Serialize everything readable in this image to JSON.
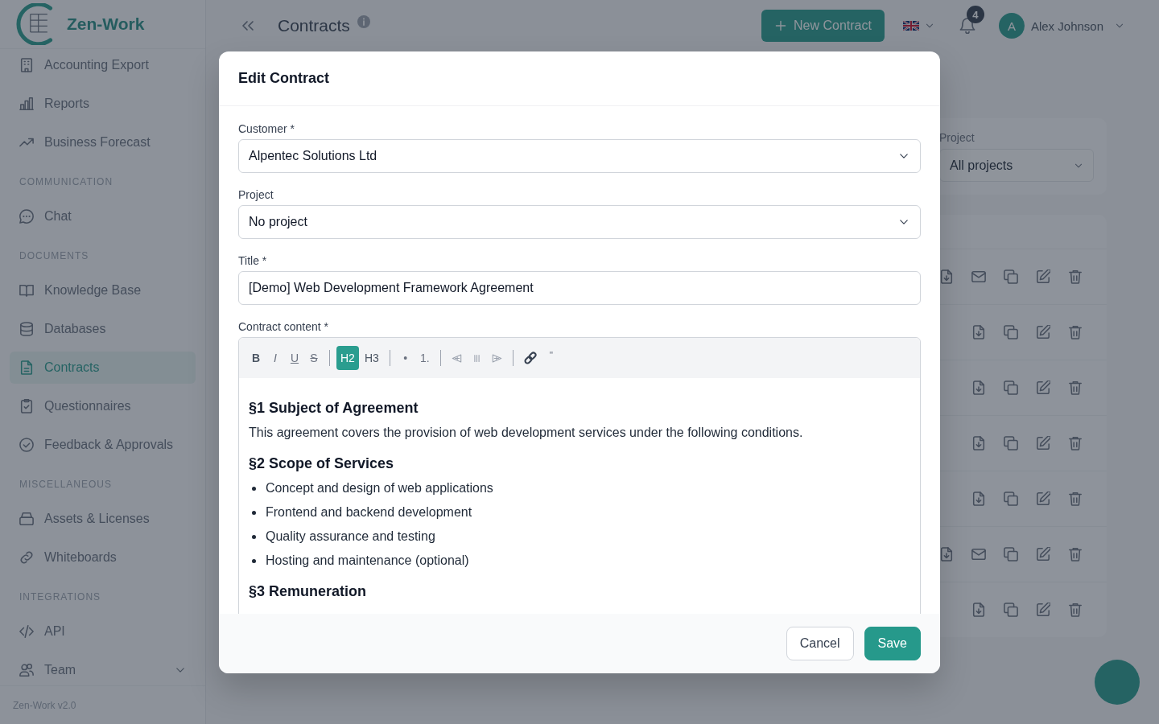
{
  "sidebar": {
    "logo": "Zen-Work",
    "sections": [
      {
        "items": [
          {
            "label": "Accounting Export",
            "selected": false
          },
          {
            "label": "Reports",
            "selected": false
          },
          {
            "label": "Business Forecast",
            "selected": false
          }
        ]
      },
      {
        "title": "COMMUNICATION",
        "items": [
          {
            "label": "Chat",
            "selected": false
          }
        ]
      },
      {
        "title": "DOCUMENTS",
        "items": [
          {
            "label": "Knowledge Base",
            "selected": false
          },
          {
            "label": "Databases",
            "selected": false
          },
          {
            "label": "Contracts",
            "selected": true
          },
          {
            "label": "Questionnaires",
            "selected": false
          },
          {
            "label": "Feedback & Approvals",
            "selected": false
          }
        ]
      },
      {
        "title": "MISCELLANEOUS",
        "items": [
          {
            "label": "Assets & Licenses",
            "selected": false
          },
          {
            "label": "Whiteboards",
            "selected": false
          }
        ]
      },
      {
        "title": "INTEGRATIONS",
        "items": [
          {
            "label": "API",
            "selected": false
          },
          {
            "label": "Team",
            "selected": false,
            "expanded": false
          }
        ]
      }
    ],
    "version": "Zen-Work v2.0"
  },
  "header": {
    "title": "Contracts",
    "new_button": "New Contract",
    "notification_count": "4",
    "user": {
      "initial": "A",
      "name": "Alex Johnson"
    }
  },
  "filters": {
    "label": "Project",
    "value": "All projects"
  },
  "table": {
    "rows": [
      {
        "actions": [
          {
            "kind": "download"
          },
          {
            "kind": "mail"
          },
          {
            "kind": "copy"
          },
          {
            "kind": "edit"
          },
          {
            "kind": "trash"
          }
        ]
      },
      {
        "actions": [
          {
            "kind": "download"
          },
          {
            "kind": "copy"
          },
          {
            "kind": "edit"
          },
          {
            "kind": "trash"
          }
        ]
      },
      {
        "actions": [
          {
            "kind": "download"
          },
          {
            "kind": "copy"
          },
          {
            "kind": "edit"
          },
          {
            "kind": "trash"
          }
        ]
      },
      {
        "actions": [
          {
            "kind": "download"
          },
          {
            "kind": "copy"
          },
          {
            "kind": "edit"
          },
          {
            "kind": "trash"
          }
        ]
      },
      {
        "actions": [
          {
            "kind": "download"
          },
          {
            "kind": "copy"
          },
          {
            "kind": "edit"
          },
          {
            "kind": "trash"
          }
        ]
      },
      {
        "actions": [
          {
            "kind": "download"
          },
          {
            "kind": "mail"
          },
          {
            "kind": "copy"
          },
          {
            "kind": "edit"
          },
          {
            "kind": "trash"
          }
        ]
      },
      {
        "actions": [
          {
            "kind": "download"
          },
          {
            "kind": "copy"
          },
          {
            "kind": "edit"
          },
          {
            "kind": "trash"
          }
        ]
      }
    ]
  },
  "modal": {
    "title": "Edit Contract",
    "fields": [
      {
        "kind": "select",
        "label": "Customer *",
        "value": "Alpentec Solutions Ltd"
      },
      {
        "kind": "select",
        "label": "Project",
        "value": "No project"
      },
      {
        "kind": "text",
        "label": "Title *",
        "value": "[Demo] Web Development Framework Agreement"
      }
    ],
    "editor": {
      "label": "Contract content *",
      "toolbar": [
        [
          {
            "kind": "bold",
            "label": "B",
            "selected": false
          },
          {
            "kind": "italic",
            "label": "I",
            "selected": false
          },
          {
            "kind": "underline",
            "label": "U",
            "selected": false
          },
          {
            "kind": "strike",
            "label": "S",
            "selected": false
          }
        ],
        [
          {
            "kind": "heading",
            "label": "H2",
            "selected": true
          },
          {
            "kind": "heading",
            "label": "H3",
            "selected": false
          }
        ],
        [
          {
            "kind": "bullet",
            "label": "•",
            "selected": false
          },
          {
            "kind": "ordered",
            "label": "1.",
            "selected": false
          }
        ],
        [
          {
            "kind": "align-left",
            "selected": false
          },
          {
            "kind": "align-center",
            "selected": false
          },
          {
            "kind": "align-right",
            "selected": false
          }
        ],
        [
          {
            "kind": "link",
            "selected": false
          },
          {
            "kind": "quote",
            "label": "\"",
            "selected": false
          }
        ]
      ],
      "content": [
        {
          "kind": "heading",
          "text": "§1 Subject of Agreement"
        },
        {
          "kind": "paragraph",
          "text": "This agreement covers the provision of web development services under the following conditions."
        },
        {
          "kind": "heading",
          "text": "§2 Scope of Services"
        },
        {
          "kind": "list",
          "items": [
            "Concept and design of web applications",
            "Frontend and backend development",
            "Quality assurance and testing",
            "Hosting and maintenance (optional)"
          ]
        },
        {
          "kind": "heading",
          "text": "§3 Remuneration"
        }
      ]
    },
    "buttons": [
      {
        "kind": "secondary",
        "label": "Cancel"
      },
      {
        "kind": "primary",
        "label": "Save"
      }
    ]
  }
}
